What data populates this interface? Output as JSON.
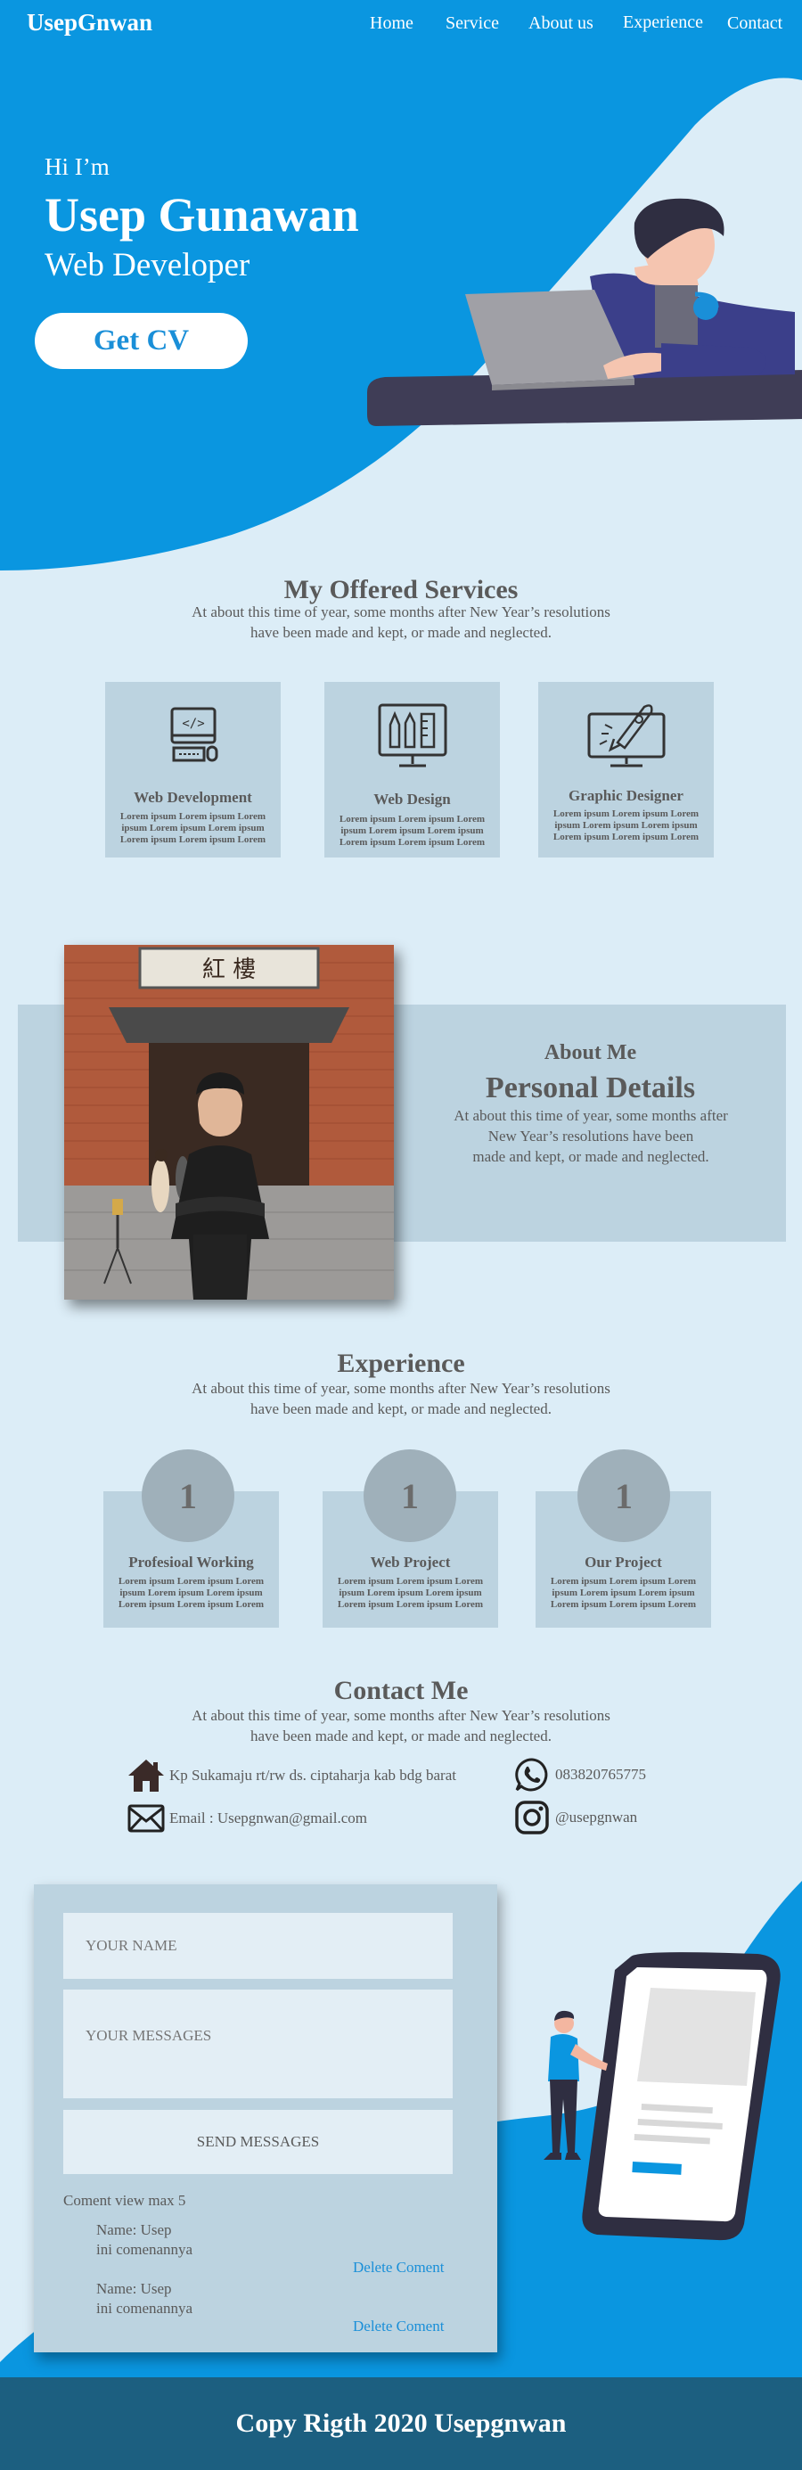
{
  "nav": {
    "brand": "UsepGnwan",
    "items": [
      "Home",
      "Service",
      "About us",
      "Experience",
      "Contact"
    ]
  },
  "hero": {
    "greeting": "Hi I’m",
    "name": "Usep Gunawan",
    "role": "Web Developer",
    "cta": "Get CV"
  },
  "services": {
    "title": "My Offered Services",
    "subtitle_line1": "At about this time of year, some months after New Year’s resolutions",
    "subtitle_line2": "have been made and kept, or made and neglected.",
    "cards": [
      {
        "icon": "code-laptop-icon",
        "title": "Web Development",
        "desc": "Lorem ipsum Lorem ipsum Lorem ipsum Lorem ipsum Lorem ipsum Lorem ipsum Lorem ipsum Lorem"
      },
      {
        "icon": "design-tools-icon",
        "title": "Web Design",
        "desc": "Lorem ipsum Lorem ipsum Lorem ipsum Lorem ipsum Lorem ipsum Lorem ipsum Lorem ipsum Lorem"
      },
      {
        "icon": "rocket-monitor-icon",
        "title": "Graphic Designer",
        "desc": "Lorem ipsum Lorem ipsum Lorem ipsum Lorem ipsum Lorem ipsum Lorem ipsum Lorem ipsum Lorem"
      }
    ]
  },
  "about": {
    "kicker": "About Me",
    "title": "Personal Details",
    "text_line1": "At about this time of year, some months after",
    "text_line2": "New Year’s resolutions have been",
    "text_line3": "made and kept, or made and neglected.",
    "sign_text": "紅 樓"
  },
  "experience": {
    "title": "Experience",
    "subtitle_line1": "At about this time of year, some months after New Year’s resolutions",
    "subtitle_line2": "have been made and kept, or made and neglected.",
    "cards": [
      {
        "number": "1",
        "title": "Profesioal Working",
        "desc": "Lorem ipsum Lorem ipsum Lorem ipsum Lorem ipsum Lorem ipsum Lorem ipsum Lorem ipsum Lorem"
      },
      {
        "number": "1",
        "title": "Web Project",
        "desc": "Lorem ipsum Lorem ipsum Lorem ipsum Lorem ipsum Lorem ipsum Lorem ipsum Lorem ipsum Lorem"
      },
      {
        "number": "1",
        "title": "Our Project",
        "desc": "Lorem ipsum Lorem ipsum Lorem ipsum Lorem ipsum Lorem ipsum Lorem ipsum Lorem ipsum Lorem"
      }
    ]
  },
  "contact": {
    "title": "Contact Me",
    "subtitle_line1": "At about this time of year, some months after New Year’s resolutions",
    "subtitle_line2": "have been made and kept, or made and neglected.",
    "address": "Kp Sukamaju rt/rw ds. ciptaharja kab bdg barat",
    "phone": "083820765775",
    "email": "Email : Usepgnwan@gmail.com",
    "instagram": "@usepgnwan"
  },
  "form": {
    "name_placeholder": "YOUR NAME",
    "message_placeholder": "YOUR MESSAGES",
    "send_label": "SEND MESSAGES",
    "comment_limit": "Coment view max 5",
    "comments": [
      {
        "name": "Name: Usep",
        "text": "ini comenannya",
        "delete": "Delete Coment"
      },
      {
        "name": "Name: Usep",
        "text": "ini comenannya",
        "delete": "Delete Coment"
      }
    ]
  },
  "footer": {
    "text": "Copy Rigth 2020 Usepgnwan"
  },
  "colors": {
    "primary": "#0a96e0",
    "background": "#dcedf7",
    "card": "#bcd3e0",
    "footer": "#1c5f80",
    "link": "#1a8fd8"
  }
}
